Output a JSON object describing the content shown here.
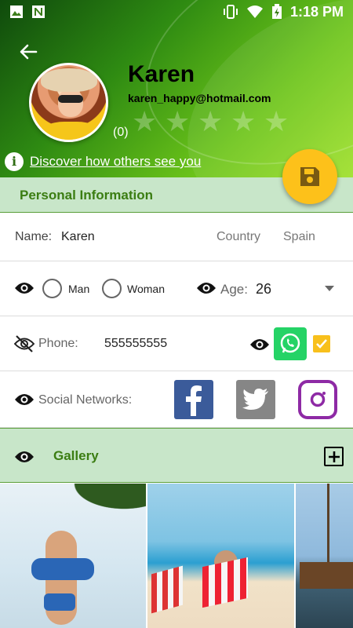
{
  "status_bar": {
    "time": "1:18 PM",
    "left_icons": [
      "image-icon",
      "n-app-icon"
    ],
    "right_icons": [
      "vibrate-icon",
      "wifi-icon",
      "battery-charging-icon"
    ]
  },
  "profile": {
    "name": "Karen",
    "email": "karen_happy@hotmail.com",
    "rating_count": "(0)",
    "stars": 5,
    "rating_value": 0,
    "discover_link": "Discover how others see you"
  },
  "colors": {
    "header_green": "#4caf1a",
    "section_bg": "#c8e6c9",
    "section_text": "#3b7d12",
    "fab": "#fdc11a",
    "whatsapp": "#25d366",
    "facebook": "#3b5b9a",
    "twitter": "#868686",
    "instagram": "#8e2aa5"
  },
  "personal": {
    "title": "Personal Information",
    "name_label": "Name:",
    "name_value": "Karen",
    "country_label": "Country",
    "country_value": "Spain",
    "gender_man": "Man",
    "gender_woman": "Woman",
    "age_label": "Age:",
    "age_value": "26",
    "phone_label": "Phone:",
    "phone_value": "555555555",
    "social_label": "Social Networks:"
  },
  "gallery": {
    "title": "Gallery",
    "photos": [
      "beach-woman-photo",
      "beach-chairs-photo",
      "ship-harbor-photo"
    ]
  }
}
